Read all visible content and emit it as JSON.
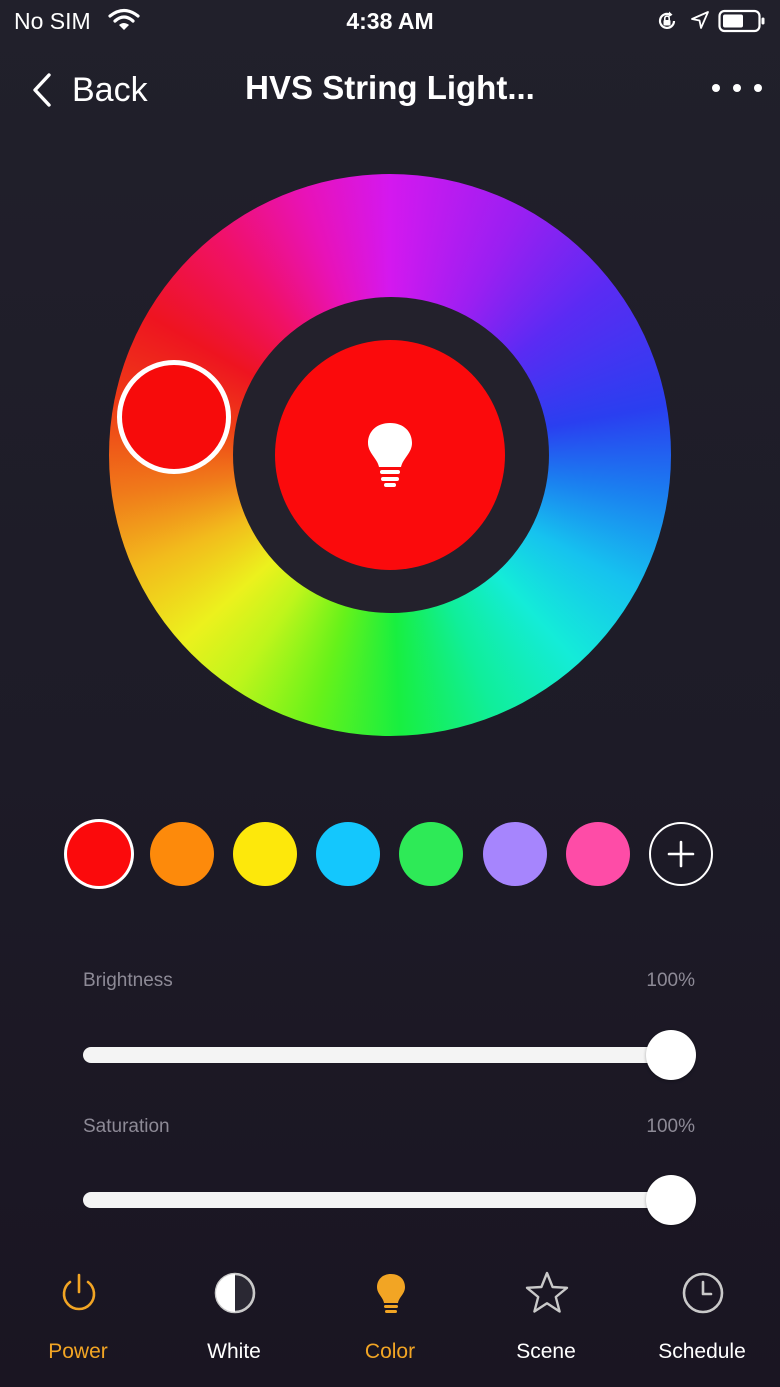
{
  "status_bar": {
    "carrier": "No SIM",
    "time": "4:38 AM",
    "icons": [
      "wifi-icon",
      "orientation-lock-icon",
      "location-icon",
      "battery-icon"
    ]
  },
  "nav": {
    "back_label": "Back",
    "title": "HVS String Light...",
    "more_icon": "more-icon"
  },
  "color_wheel": {
    "selected_color": "#fb0a0c",
    "center_icon": "bulb-icon"
  },
  "presets": {
    "colors": [
      "#fb0a0c",
      "#fd8a0b",
      "#fde80b",
      "#14c7fd",
      "#2eea57",
      "#a685fd",
      "#fe4ca7"
    ],
    "selected_index": 0,
    "add_icon": "plus-icon"
  },
  "brightness": {
    "label": "Brightness",
    "value_text": "100%",
    "value": 1.0
  },
  "saturation": {
    "label": "Saturation",
    "value_text": "100%",
    "value": 1.0
  },
  "tabbar": {
    "active_color": "#f2a524",
    "tabs": [
      {
        "label": "Power",
        "icon": "power-icon",
        "active": true
      },
      {
        "label": "White",
        "icon": "white-balance-icon",
        "active": false
      },
      {
        "label": "Color",
        "icon": "bulb-icon",
        "active": true
      },
      {
        "label": "Scene",
        "icon": "star-icon",
        "active": false
      },
      {
        "label": "Schedule",
        "icon": "clock-icon",
        "active": false
      }
    ]
  }
}
